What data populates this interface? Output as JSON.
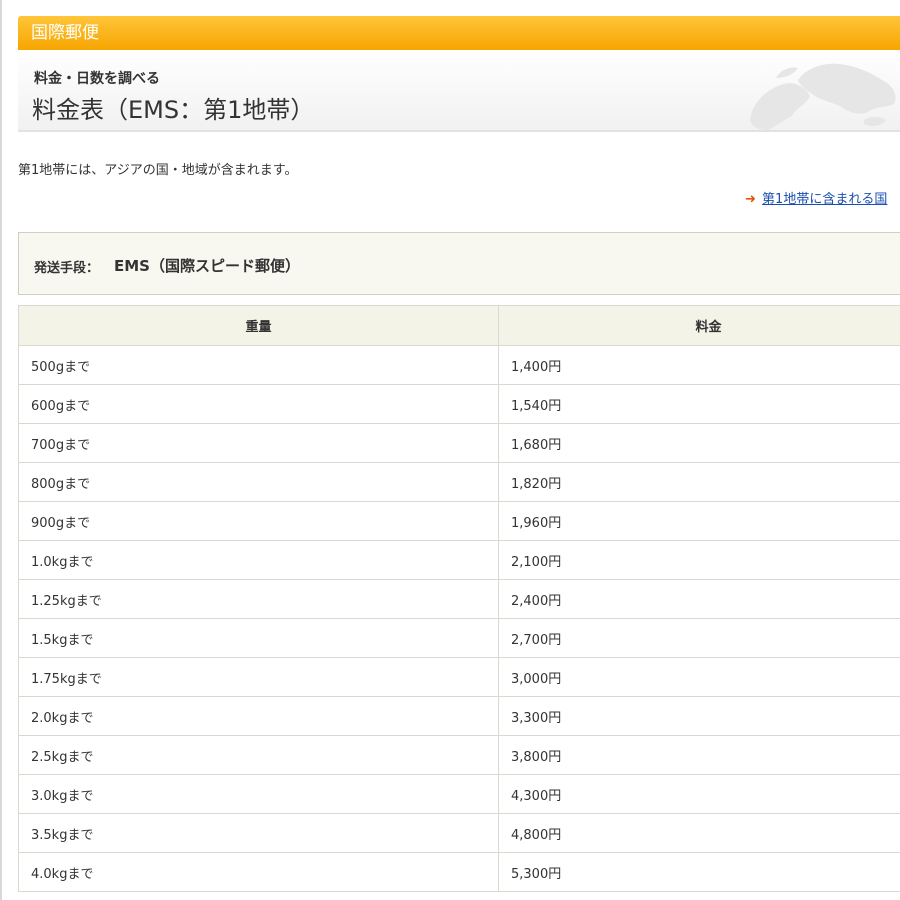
{
  "header": {
    "section_label": "国際郵便",
    "subtitle": "料金・日数を調べる",
    "title": "料金表（EMS：第1地帯）"
  },
  "intro": {
    "text": "第1地帯には、アジアの国・地域が含まれます。",
    "link_arrow": "➜",
    "link_text": "第1地帯に含まれる国"
  },
  "method": {
    "label": "発送手段：",
    "value": "EMS（国際スピード郵便）"
  },
  "table": {
    "columns": [
      "重量",
      "料金"
    ],
    "rows": [
      {
        "weight": "500gまで",
        "price": "1,400円"
      },
      {
        "weight": "600gまで",
        "price": "1,540円"
      },
      {
        "weight": "700gまで",
        "price": "1,680円"
      },
      {
        "weight": "800gまで",
        "price": "1,820円"
      },
      {
        "weight": "900gまで",
        "price": "1,960円"
      },
      {
        "weight": "1.0kgまで",
        "price": "2,100円"
      },
      {
        "weight": "1.25kgまで",
        "price": "2,400円"
      },
      {
        "weight": "1.5kgまで",
        "price": "2,700円"
      },
      {
        "weight": "1.75kgまで",
        "price": "3,000円"
      },
      {
        "weight": "2.0kgまで",
        "price": "3,300円"
      },
      {
        "weight": "2.5kgまで",
        "price": "3,800円"
      },
      {
        "weight": "3.0kgまで",
        "price": "4,300円"
      },
      {
        "weight": "3.5kgまで",
        "price": "4,800円"
      },
      {
        "weight": "4.0kgまで",
        "price": "5,300円"
      }
    ]
  },
  "colors": {
    "section_bar": "#f7a500",
    "link": "#1a4fb0",
    "arrow": "#e8500a",
    "table_header_bg": "#f4f3e7"
  }
}
